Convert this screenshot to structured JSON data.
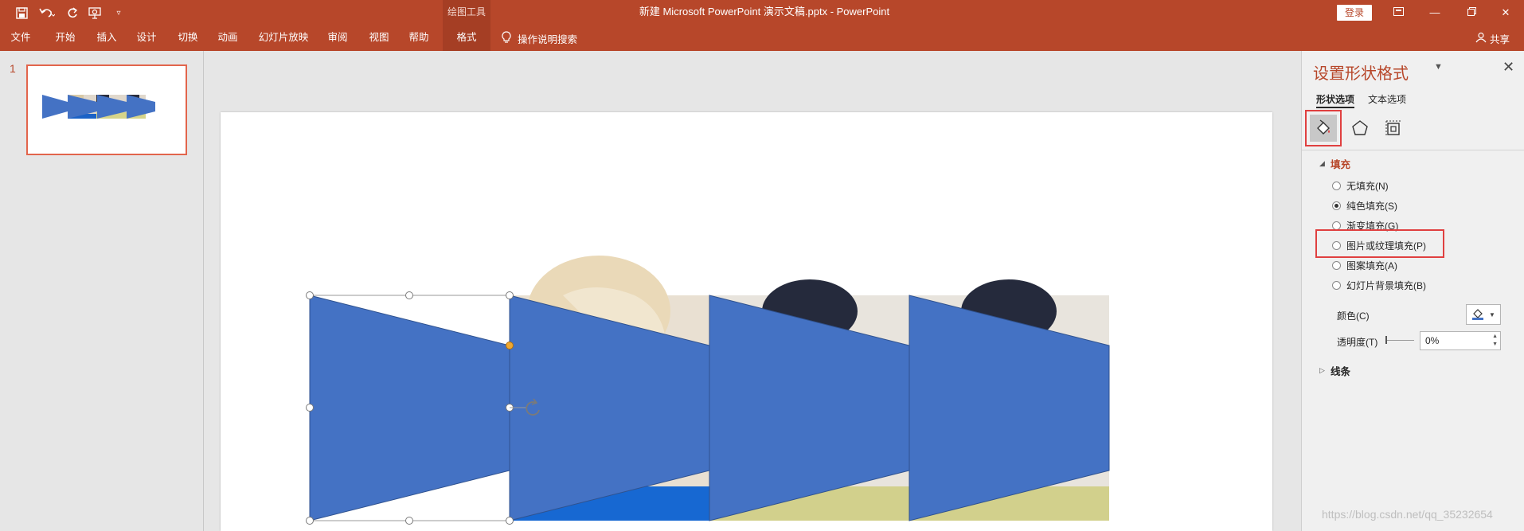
{
  "title_bar": {
    "document_title": "新建 Microsoft PowerPoint 演示文稿.pptx  -  PowerPoint",
    "context_group": "绘图工具",
    "login_label": "登录",
    "quick_access_icons": [
      "save-icon",
      "undo-icon",
      "redo-icon",
      "present-icon",
      "customize-icon"
    ],
    "window_controls": [
      "ribbon-display-icon",
      "minimize-icon",
      "restore-icon",
      "close-icon"
    ]
  },
  "ribbon": {
    "tabs": [
      "文件",
      "开始",
      "插入",
      "设计",
      "切换",
      "动画",
      "幻灯片放映",
      "审阅",
      "视图",
      "帮助",
      "格式"
    ],
    "active_tab": "格式",
    "tell_me": "操作说明搜索",
    "share": "共享"
  },
  "thumbnails": {
    "slide_number": "1"
  },
  "format_pane": {
    "title": "设置形状格式",
    "tabs": {
      "shape": "形状选项",
      "text": "文本选项"
    },
    "category_icons": [
      "fill-line-icon",
      "effects-icon",
      "size-properties-icon"
    ],
    "fill_section": "填充",
    "fill_options": [
      {
        "label": "无填充(N)",
        "selected": false
      },
      {
        "label": "纯色填充(S)",
        "selected": true
      },
      {
        "label": "渐变填充(G)",
        "selected": false
      },
      {
        "label": "图片或纹理填充(P)",
        "selected": false
      },
      {
        "label": "图案填充(A)",
        "selected": false
      },
      {
        "label": "幻灯片背景填充(B)",
        "selected": false
      }
    ],
    "color_label": "颜色(C)",
    "transparency_label": "透明度(T)",
    "transparency_value": "0%",
    "line_section": "线条"
  },
  "colors": {
    "accent": "#b7472a",
    "shape_fill": "#4472c4",
    "highlight": "#e04040"
  },
  "watermark": "https://blog.csdn.net/qq_35232654"
}
